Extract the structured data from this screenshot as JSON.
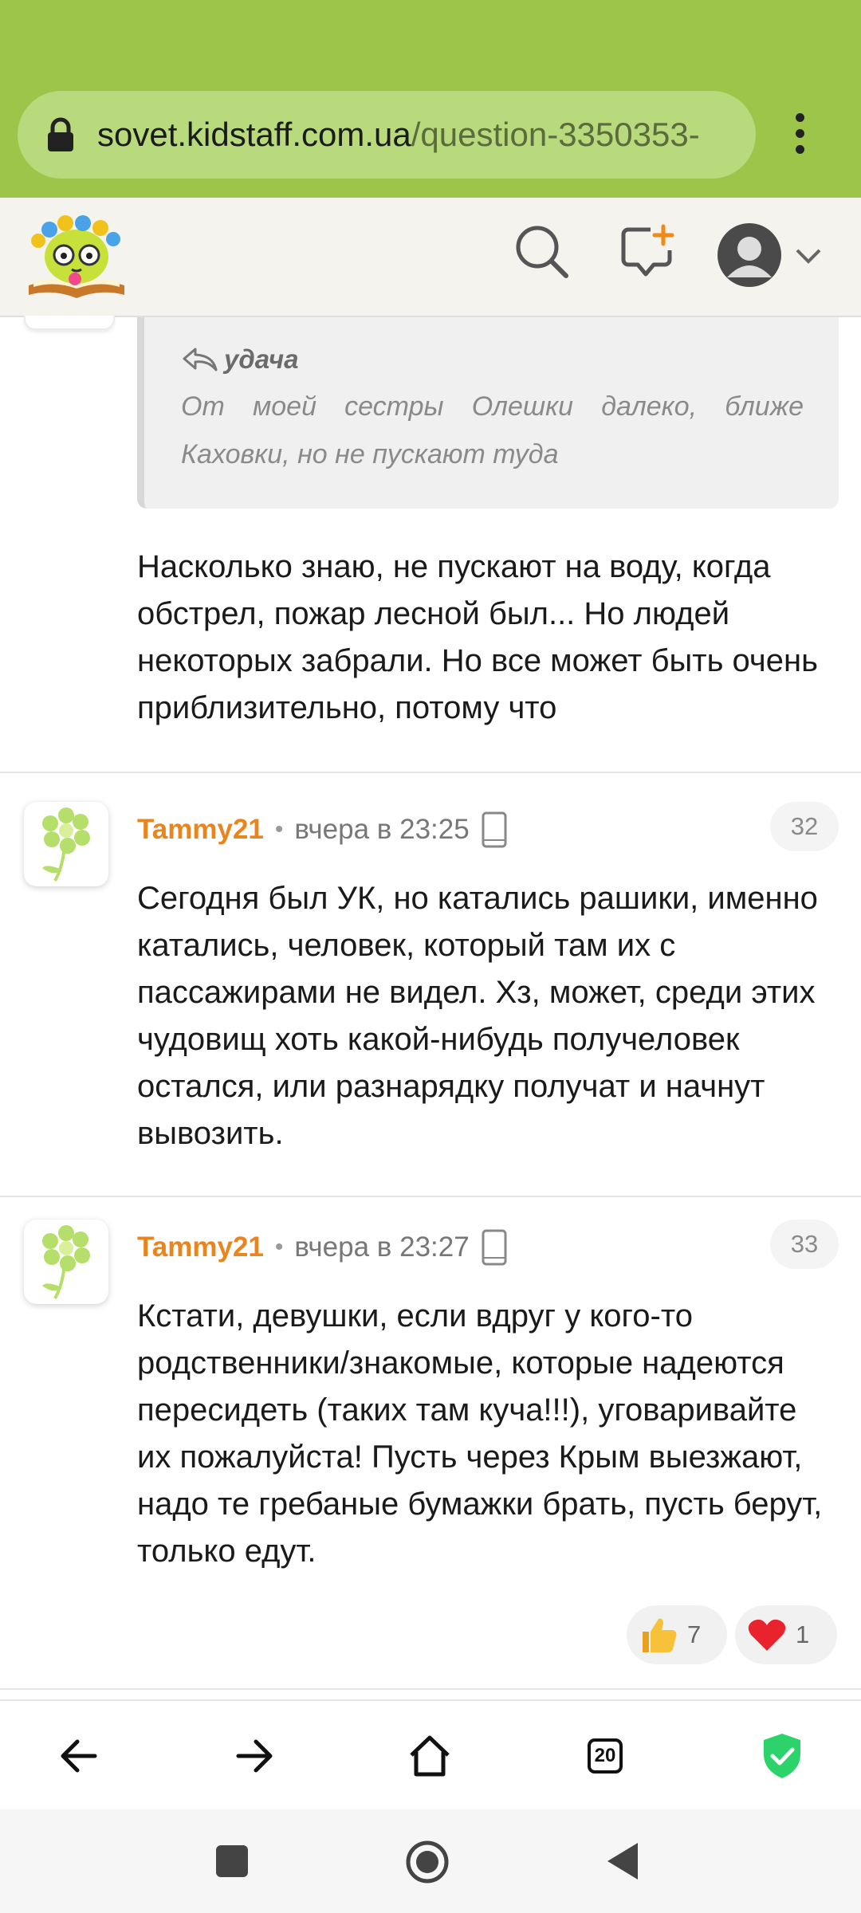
{
  "browser": {
    "url_host": "sovet.kidstaff.com.ua",
    "url_path": "/question-3350353-",
    "menu_icon": "more-vert-icon",
    "theme_color": "#9dc54a"
  },
  "site_header": {
    "logo_icon": "kidstaff-logo",
    "search_icon": "search-icon",
    "new_topic_icon": "new-message-icon",
    "account_icon": "user-avatar-icon",
    "dropdown_icon": "chevron-down-icon"
  },
  "quote": {
    "author": "удача",
    "text": "От моей сестры Олешки далеко, ближе Каховки, но не пускают туда"
  },
  "reply_text": "Насколько знаю, не пускают на воду, когда обстрел, пожар лесной был... Но людей некоторых забрали. Но все может быть очень приблизительно, потому что",
  "comments": [
    {
      "author": "Tammy21",
      "time": "вчера в 23:25",
      "number": "32",
      "text": "Сегодня был УК, но катались рашики, именно катались, человек, который там их с пассажирами не видел. Хз, может, среди этих чудовищ хоть какой-нибудь получеловек остался, или разнарядку получат и начнут вывозить."
    },
    {
      "author": "Tammy21",
      "time": "вчера в 23:27",
      "number": "33",
      "text": "Кстати, девушки, если вдруг у кого-то родственники/знакомые, которые надеются пересидеть (таких там куча!!!), уговаривайте их пожалуйста! Пусть через Крым выезжают, надо те гребаные бумажки брать, пусть берут, только едут.",
      "reactions": [
        {
          "icon": "thumbs-up-icon",
          "count": "7"
        },
        {
          "icon": "heart-icon",
          "count": "1"
        }
      ]
    }
  ],
  "accent_colors": {
    "author": "#e8851f",
    "shield": "#2bd36a"
  },
  "bottom_nav": {
    "back_icon": "arrow-left-icon",
    "forward_icon": "arrow-right-icon",
    "home_icon": "home-icon",
    "tabs_count": "20",
    "shield_icon": "shield-check-icon"
  },
  "system_nav": {
    "recents_icon": "square-icon",
    "home_icon": "circle-icon",
    "back_icon": "triangle-back-icon"
  }
}
